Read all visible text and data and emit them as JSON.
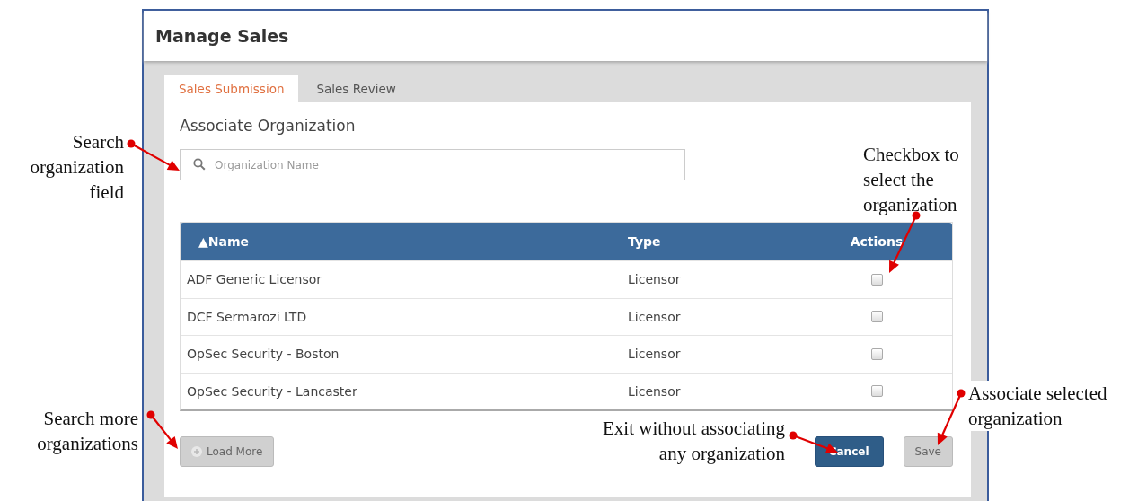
{
  "window": {
    "title": "Manage Sales"
  },
  "tabs": [
    {
      "label": "Sales Submission",
      "selected": true
    },
    {
      "label": "Sales Review",
      "selected": false
    }
  ],
  "section_title": "Associate Organization",
  "search": {
    "placeholder": "Organization Name"
  },
  "table": {
    "columns": [
      {
        "label": "Name",
        "sort_mark": "▲"
      },
      {
        "label": "Type"
      },
      {
        "label": "Actions"
      }
    ],
    "rows": [
      {
        "name": "ADF Generic Licensor",
        "type": "Licensor",
        "checked": false
      },
      {
        "name": "DCF Sermarozi LTD",
        "type": "Licensor",
        "checked": false
      },
      {
        "name": "OpSec Security - Boston",
        "type": "Licensor",
        "checked": false
      },
      {
        "name": "OpSec Security - Lancaster",
        "type": "Licensor",
        "checked": false
      }
    ]
  },
  "buttons": [
    {
      "label": "Load More",
      "kind": "secondary"
    },
    {
      "label": "Cancel",
      "kind": "primary"
    },
    {
      "label": "Save",
      "kind": "secondary"
    }
  ],
  "annotations": [
    "Search organization field",
    "Checkbox to select the organization",
    "Search more organizations",
    "Exit without associating any organization",
    "Associate selected organization"
  ]
}
